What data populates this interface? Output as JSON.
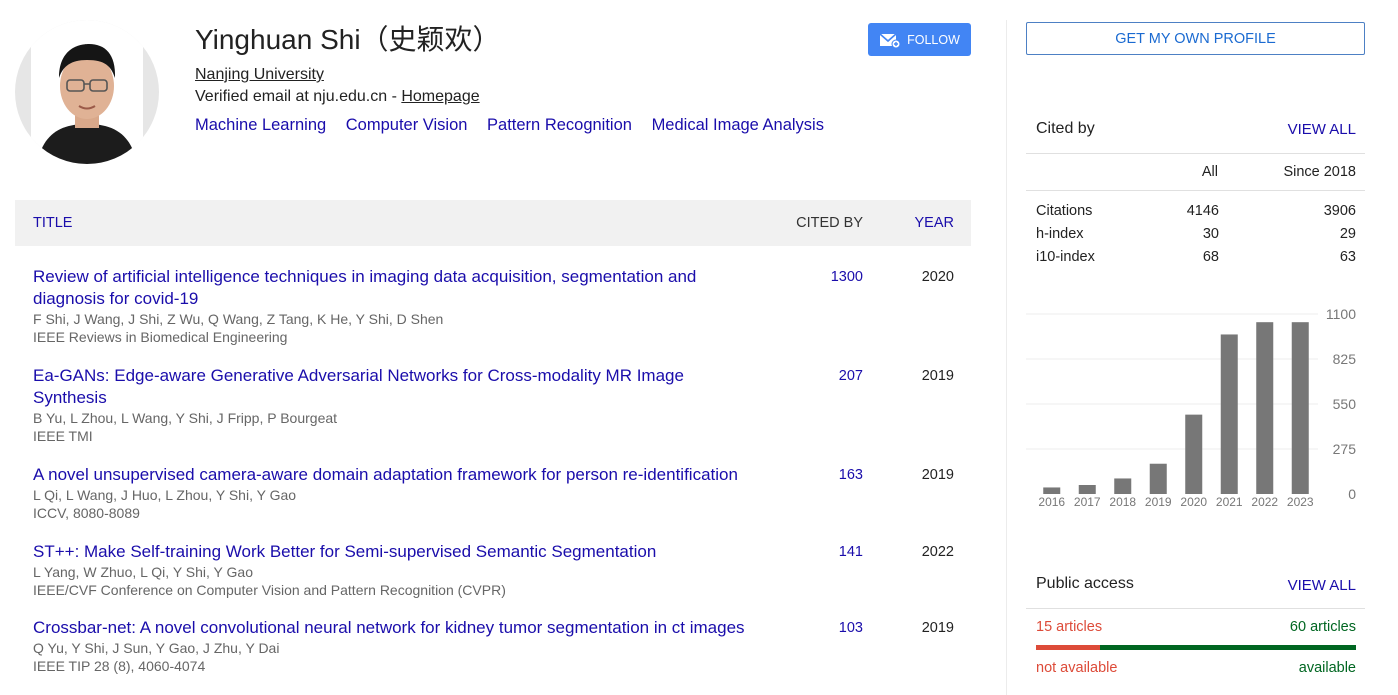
{
  "profile": {
    "name": "Yinghuan Shi（史颖欢）",
    "affiliation": "Nanjing University",
    "email_text": "Verified email at nju.edu.cn - ",
    "homepage_label": "Homepage",
    "interests": [
      "Machine Learning",
      "Computer Vision",
      "Pattern Recognition",
      "Medical Image Analysis"
    ],
    "follow_label": "FOLLOW"
  },
  "table": {
    "headers": {
      "title": "TITLE",
      "cited_by": "CITED BY",
      "year": "YEAR"
    },
    "articles": [
      {
        "title": "Review of artificial intelligence techniques in imaging data acquisition, segmentation and diagnosis for covid-19",
        "authors": "F Shi, J Wang, J Shi, Z Wu, Q Wang, Z Tang, K He, Y Shi, D Shen",
        "venue": "IEEE Reviews in Biomedical Engineering",
        "cited_by": "1300",
        "year": "2020"
      },
      {
        "title": "Ea-GANs: Edge-aware Generative Adversarial Networks for Cross-modality MR Image Synthesis",
        "authors": "B Yu, L Zhou, L Wang, Y Shi, J Fripp, P Bourgeat",
        "venue": "IEEE TMI",
        "cited_by": "207",
        "year": "2019"
      },
      {
        "title": "A novel unsupervised camera-aware domain adaptation framework for person re-identification",
        "authors": "L Qi, L Wang, J Huo, L Zhou, Y Shi, Y Gao",
        "venue": "ICCV, 8080-8089",
        "cited_by": "163",
        "year": "2019"
      },
      {
        "title": "ST++: Make Self-training Work Better for Semi-supervised Semantic Segmentation",
        "authors": "L Yang, W Zhuo, L Qi, Y Shi, Y Gao",
        "venue": "IEEE/CVF Conference on Computer Vision and Pattern Recognition (CVPR)",
        "cited_by": "141",
        "year": "2022"
      },
      {
        "title": "Crossbar-net: A novel convolutional neural network for kidney tumor segmentation in ct images",
        "authors": "Q Yu, Y Shi, J Sun, Y Gao, J Zhu, Y Dai",
        "venue": "IEEE TIP 28 (8), 4060-4074",
        "cited_by": "103",
        "year": "2019"
      }
    ]
  },
  "sidebar": {
    "own_profile_label": "GET MY OWN PROFILE",
    "cited_by": {
      "title": "Cited by",
      "view_all": "VIEW ALL",
      "col_all": "All",
      "col_since": "Since 2018",
      "rows": [
        {
          "label": "Citations",
          "all": "4146",
          "since": "3906"
        },
        {
          "label": "h-index",
          "all": "30",
          "since": "29"
        },
        {
          "label": "i10-index",
          "all": "68",
          "since": "63"
        }
      ]
    },
    "public_access": {
      "title": "Public access",
      "view_all": "VIEW ALL",
      "not_available_count": "15 articles",
      "available_count": "60 articles",
      "not_available_label": "not available",
      "available_label": "available",
      "not_available_fraction": 0.2
    }
  },
  "chart_data": {
    "type": "bar",
    "categories": [
      "2016",
      "2017",
      "2018",
      "2019",
      "2020",
      "2021",
      "2022",
      "2023"
    ],
    "values": [
      40,
      55,
      95,
      185,
      485,
      975,
      1050,
      1050
    ],
    "yticks": [
      0,
      275,
      550,
      825,
      1100
    ],
    "ylim": [
      0,
      1100
    ],
    "color": "#777777"
  },
  "colors": {
    "link": "#1a0dab",
    "follow": "#4285f4",
    "not_available": "#dd4b39",
    "available": "#006621"
  }
}
